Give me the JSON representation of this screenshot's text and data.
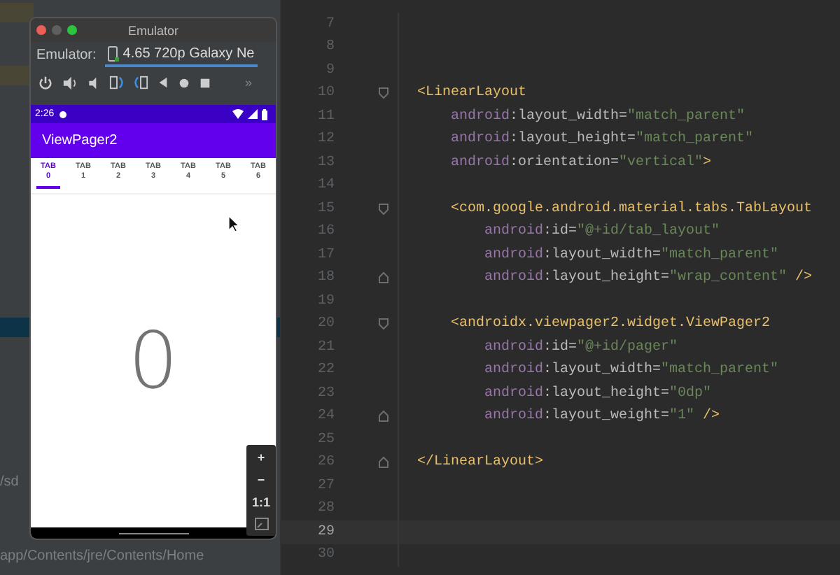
{
  "background_panel": {
    "texts": [
      "/sd",
      "app/Contents/jre/Contents/Home"
    ]
  },
  "emulator": {
    "title": "Emulator",
    "label": "Emulator:",
    "device": "4.65 720p Galaxy Ne",
    "more": "»",
    "phone": {
      "time": "2:26",
      "app_title": "ViewPager2",
      "tabs": [
        {
          "label": "TAB 0",
          "selected": true
        },
        {
          "label": "TAB 1",
          "selected": false
        },
        {
          "label": "TAB 2",
          "selected": false
        },
        {
          "label": "TAB 3",
          "selected": false
        },
        {
          "label": "TAB 4",
          "selected": false
        },
        {
          "label": "TAB 5",
          "selected": false
        },
        {
          "label": "TAB 6",
          "selected": false
        }
      ],
      "page_text": "0"
    },
    "zoom_controls": [
      "+",
      "−",
      "1:1"
    ]
  },
  "editor": {
    "lines": [
      {
        "number": "7",
        "current": false,
        "kind": "plain"
      },
      {
        "number": "8",
        "current": false,
        "kind": "plain"
      },
      {
        "number": "9",
        "current": false,
        "kind": "plain"
      },
      {
        "number": "10",
        "current": false,
        "kind": "fold_start",
        "tokens": [
          {
            "kind": "tag",
            "text": "<LinearLayout"
          }
        ],
        "children": [
          {
            "number": "11",
            "current": false,
            "kind": "plain",
            "tokens": [
              {
                "kind": "ns",
                "text": "android"
              },
              {
                "kind": "attr",
                "text": ":layout_width="
              },
              {
                "kind": "value",
                "text": "\"match_parent\""
              }
            ]
          },
          {
            "number": "12",
            "current": false,
            "kind": "plain",
            "tokens": [
              {
                "kind": "ns",
                "text": "android"
              },
              {
                "kind": "attr",
                "text": ":layout_height="
              },
              {
                "kind": "value",
                "text": "\"match_parent\""
              }
            ]
          },
          {
            "number": "13",
            "current": false,
            "kind": "plain",
            "tokens": [
              {
                "kind": "ns",
                "text": "android"
              },
              {
                "kind": "attr",
                "text": ":orientation="
              },
              {
                "kind": "value",
                "text": "\"vertical\""
              },
              {
                "kind": "tag",
                "text": ">"
              }
            ]
          },
          {
            "number": "14",
            "current": false,
            "kind": "plain"
          },
          {
            "number": "15",
            "current": false,
            "kind": "fold_start",
            "tokens": [
              {
                "kind": "tag",
                "text": "<com.google.android.material.tabs.TabLayout"
              }
            ],
            "children": [
              {
                "number": "16",
                "current": false,
                "kind": "plain",
                "tokens": [
                  {
                    "kind": "ns",
                    "text": "android"
                  },
                  {
                    "kind": "attr",
                    "text": ":id="
                  },
                  {
                    "kind": "value",
                    "text": "\"@+id/tab_layout\""
                  }
                ]
              },
              {
                "number": "17",
                "current": false,
                "kind": "plain",
                "tokens": [
                  {
                    "kind": "ns",
                    "text": "android"
                  },
                  {
                    "kind": "attr",
                    "text": ":layout_width="
                  },
                  {
                    "kind": "value",
                    "text": "\"match_parent\""
                  }
                ]
              },
              {
                "number": "18",
                "current": false,
                "kind": "fold_end",
                "tokens": [
                  {
                    "kind": "ns",
                    "text": "android"
                  },
                  {
                    "kind": "attr",
                    "text": ":layout_height="
                  },
                  {
                    "kind": "value",
                    "text": "\"wrap_content\""
                  },
                  {
                    "kind": "close",
                    "text": "/>"
                  }
                ]
              }
            ]
          },
          {
            "number": "19",
            "current": false,
            "kind": "plain"
          },
          {
            "number": "20",
            "current": false,
            "kind": "fold_start",
            "tokens": [
              {
                "kind": "tag",
                "text": "<androidx.viewpager2.widget.ViewPager2"
              }
            ],
            "children": [
              {
                "number": "21",
                "current": false,
                "kind": "plain",
                "tokens": [
                  {
                    "kind": "ns",
                    "text": "android"
                  },
                  {
                    "kind": "attr",
                    "text": ":id="
                  },
                  {
                    "kind": "value",
                    "text": "\"@+id/pager\""
                  }
                ]
              },
              {
                "number": "22",
                "current": false,
                "kind": "plain",
                "tokens": [
                  {
                    "kind": "ns",
                    "text": "android"
                  },
                  {
                    "kind": "attr",
                    "text": ":layout_width="
                  },
                  {
                    "kind": "value",
                    "text": "\"match_parent\""
                  }
                ]
              },
              {
                "number": "23",
                "current": false,
                "kind": "plain",
                "tokens": [
                  {
                    "kind": "ns",
                    "text": "android"
                  },
                  {
                    "kind": "attr",
                    "text": ":layout_height="
                  },
                  {
                    "kind": "value",
                    "text": "\"0dp\""
                  }
                ]
              },
              {
                "number": "24",
                "current": false,
                "kind": "fold_end",
                "tokens": [
                  {
                    "kind": "ns",
                    "text": "android"
                  },
                  {
                    "kind": "attr",
                    "text": ":layout_weight="
                  },
                  {
                    "kind": "value",
                    "text": "\"1\""
                  },
                  {
                    "kind": "close",
                    "text": "/>"
                  }
                ]
              }
            ]
          },
          {
            "number": "25",
            "current": false,
            "kind": "plain"
          }
        ]
      },
      {
        "number": "26",
        "current": false,
        "kind": "fold_end",
        "tokens": [
          {
            "kind": "tag",
            "text": "</LinearLayout>"
          }
        ]
      },
      {
        "number": "27",
        "current": false,
        "kind": "plain"
      },
      {
        "number": "28",
        "current": false,
        "kind": "plain"
      },
      {
        "number": "29",
        "current": true,
        "kind": "plain"
      },
      {
        "number": "30",
        "current": false,
        "kind": "plain"
      }
    ]
  }
}
